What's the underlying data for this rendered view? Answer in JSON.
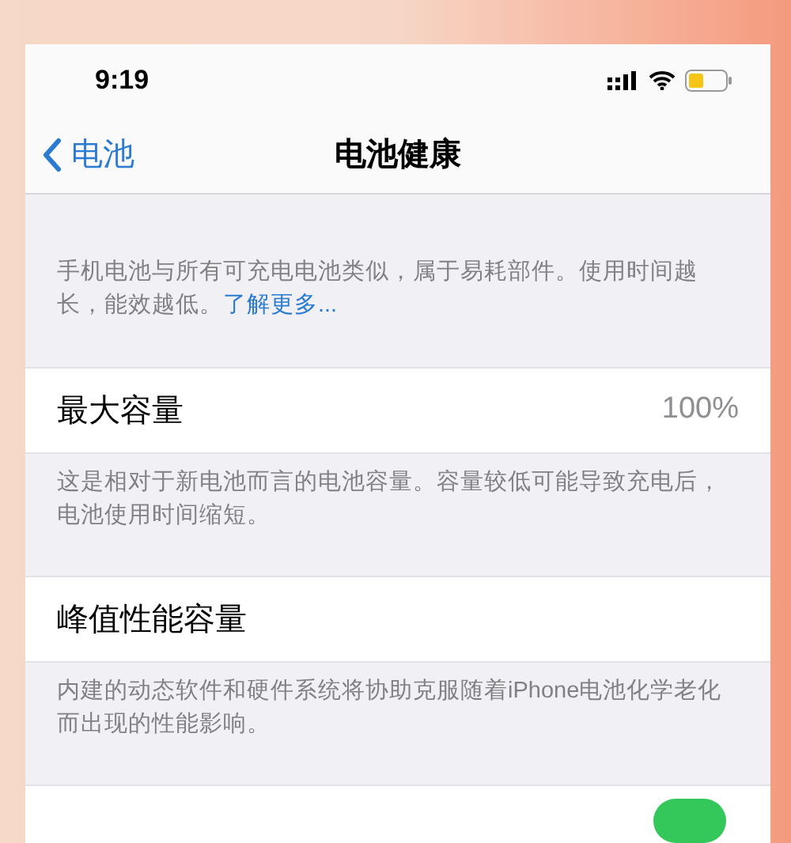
{
  "status_bar": {
    "time": "9:19"
  },
  "nav": {
    "back": "电池",
    "title": "电池健康"
  },
  "intro": {
    "text": "手机电池与所有可充电电池类似，属于易耗部件。使用时间越长，能效越低。",
    "link": "了解更多..."
  },
  "sections": [
    {
      "title": "最大容量",
      "value": "100%",
      "note": "这是相对于新电池而言的电池容量。容量较低可能导致充电后，电池使用时间缩短。"
    },
    {
      "title": "峰值性能容量",
      "note": "内建的动态软件和硬件系统将协助克服随着iPhone电池化学老化而出现的性能影响。"
    }
  ],
  "bottom_row": {
    "toggle_on": true
  }
}
